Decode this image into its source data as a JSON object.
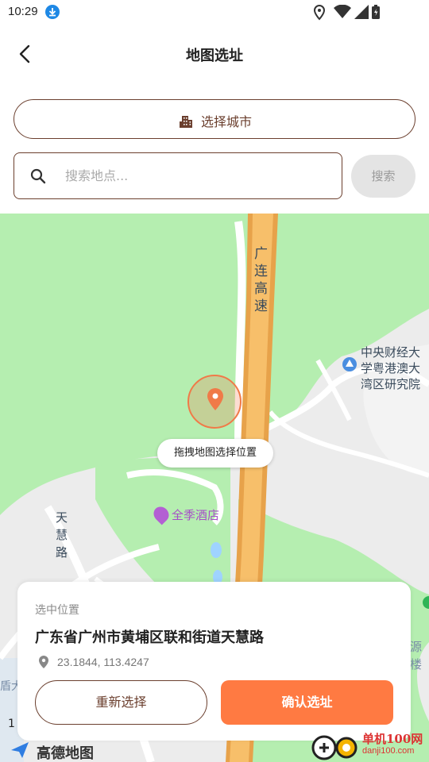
{
  "status_bar": {
    "time": "10:29"
  },
  "header": {
    "title": "地图选址"
  },
  "city_selector": {
    "label": "选择城市"
  },
  "search": {
    "placeholder": "搜索地点...",
    "button_label": "搜索"
  },
  "map": {
    "road_highway": "广连高速",
    "poi_university": "中央财经大学粤港澳大湾区研究院",
    "road_tianhui": "天慧路",
    "hotel": "全季酒店",
    "drag_tip": "拖拽地图选择位置",
    "provider_logo": "高德地图",
    "edge_label_right": "源楼",
    "edge_label_left": "盾大",
    "edge_number": "1"
  },
  "card": {
    "caption": "选中位置",
    "address": "广东省广州市黄埔区联和街道天慧路",
    "coords": "23.1844, 113.4247",
    "reselect_label": "重新选择",
    "confirm_label": "确认选址"
  },
  "watermark": {
    "title": "单机100网",
    "sub": "danji100.com"
  },
  "colors": {
    "accent": "#ff7a42",
    "brown": "#6b3f2e",
    "map_green": "#b5eeb0",
    "highway": "#f5b75e"
  }
}
